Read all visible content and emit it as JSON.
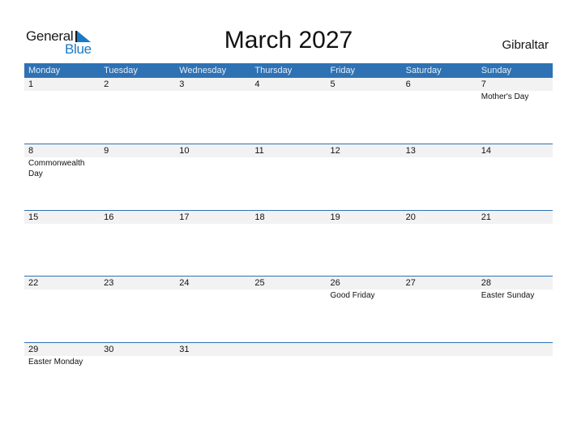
{
  "logo": {
    "word1": "General",
    "word2": "Blue"
  },
  "title": "March 2027",
  "country": "Gibraltar",
  "colors": {
    "header": "#2e72b4",
    "accent": "#1a7ac6",
    "daybar": "#f2f2f2"
  },
  "weekdays": [
    "Monday",
    "Tuesday",
    "Wednesday",
    "Thursday",
    "Friday",
    "Saturday",
    "Sunday"
  ],
  "weeks": [
    {
      "days": [
        "1",
        "2",
        "3",
        "4",
        "5",
        "6",
        "7"
      ],
      "events": [
        "",
        "",
        "",
        "",
        "",
        "",
        "Mother's Day"
      ]
    },
    {
      "days": [
        "8",
        "9",
        "10",
        "11",
        "12",
        "13",
        "14"
      ],
      "events": [
        "Commonwealth Day",
        "",
        "",
        "",
        "",
        "",
        ""
      ]
    },
    {
      "days": [
        "15",
        "16",
        "17",
        "18",
        "19",
        "20",
        "21"
      ],
      "events": [
        "",
        "",
        "",
        "",
        "",
        "",
        ""
      ]
    },
    {
      "days": [
        "22",
        "23",
        "24",
        "25",
        "26",
        "27",
        "28"
      ],
      "events": [
        "",
        "",
        "",
        "",
        "Good Friday",
        "",
        "Easter Sunday"
      ]
    },
    {
      "days": [
        "29",
        "30",
        "31",
        "",
        "",
        "",
        ""
      ],
      "events": [
        "Easter Monday",
        "",
        "",
        "",
        "",
        "",
        ""
      ]
    }
  ]
}
